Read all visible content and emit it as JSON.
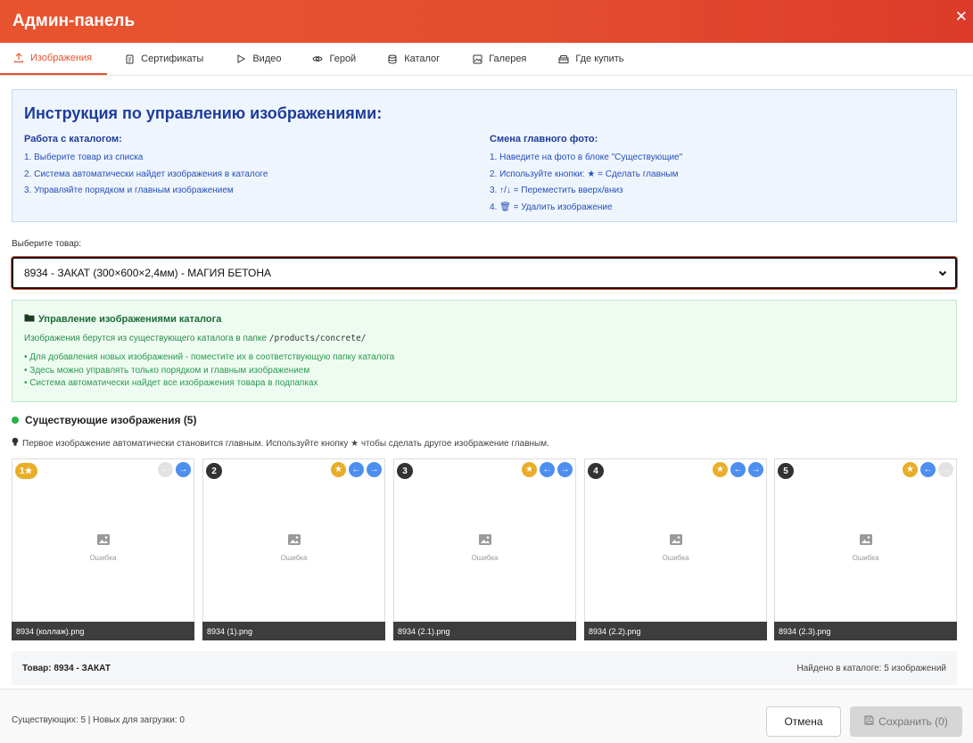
{
  "header": {
    "title": "Админ-панель",
    "close_glyph": "✕"
  },
  "tabs": [
    {
      "label": "Изображения",
      "icon": "upload-icon",
      "active": true
    },
    {
      "label": "Сертификаты",
      "icon": "document-icon"
    },
    {
      "label": "Видео",
      "icon": "play-icon"
    },
    {
      "label": "Герой",
      "icon": "eye-icon"
    },
    {
      "label": "Каталог",
      "icon": "database-icon"
    },
    {
      "label": "Галерея",
      "icon": "image-icon"
    },
    {
      "label": "Где купить",
      "icon": "store-icon"
    }
  ],
  "instructions": {
    "title": "Инструкция по управлению изображениями:",
    "left": {
      "heading": "Работа с каталогом:",
      "items": [
        "1. Выберите товар из списка",
        "2. Система автоматически найдет изображения в каталоге",
        "3. Управляйте порядком и главным изображением"
      ]
    },
    "right": {
      "heading": "Смена главного фото:",
      "items": [
        "1. Наведите на фото в блоке \"Существующие\"",
        "2. Используйте кнопки: ★ = Сделать главным",
        "3. ↑/↓ = Переместить вверх/вниз",
        "4. 🗑 = Удалить изображение"
      ]
    }
  },
  "product_select": {
    "label": "Выберите товар:",
    "value": "8934 - ЗАКАТ (300×600×2,4мм) - МАГИЯ БЕТОНА"
  },
  "catalog_info": {
    "title": "Управление изображениями каталога",
    "desc_prefix": "Изображения берутся из существующего каталога в папке ",
    "path": "/products/concrete/",
    "bullets": [
      "• Для добавления новых изображений - поместите их в соответствующую папку каталога",
      "• Здесь можно управлять только порядком и главным изображением",
      "• Система автоматически найдет все изображения товара в подпапках"
    ]
  },
  "existing": {
    "title": "Существующие изображения (5)",
    "hint": "Первое изображение автоматически становится главным. Используйте кнопку ★ чтобы сделать другое изображение главным.",
    "error_text": "Ошибка",
    "images": [
      {
        "badge": "1★",
        "filename": "8934 (коллаж).png",
        "is_main": true
      },
      {
        "badge": "2",
        "filename": "8934 (1).png",
        "is_main": false
      },
      {
        "badge": "3",
        "filename": "8934 (2.1).png",
        "is_main": false
      },
      {
        "badge": "4",
        "filename": "8934 (2.2).png",
        "is_main": false
      },
      {
        "badge": "5",
        "filename": "8934 (2.3).png",
        "is_main": false
      }
    ]
  },
  "summary": {
    "product": "Товар: 8934 - ЗАКАТ",
    "found": "Найдено в каталоге: 5 изображений"
  },
  "footer": {
    "stats": "Существующих: 5 | Новых для загрузки: 0",
    "cancel": "Отмена",
    "save": "Сохранить (0)"
  },
  "colors": {
    "header_accent": "#e4502f",
    "main_badge": "#e9ad28",
    "action_blue": "#4d8eef",
    "success_green": "#27b24a"
  }
}
